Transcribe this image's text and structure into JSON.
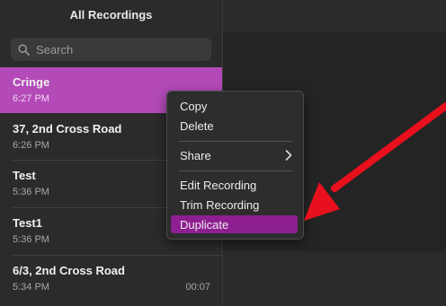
{
  "sidebar": {
    "title": "All Recordings",
    "search_placeholder": "Search",
    "recordings": [
      {
        "name": "Cringe",
        "time": "6:27 PM",
        "duration": ""
      },
      {
        "name": "37, 2nd Cross Road",
        "time": "6:26 PM",
        "duration": ""
      },
      {
        "name": "Test",
        "time": "5:36 PM",
        "duration": ""
      },
      {
        "name": "Test1",
        "time": "5:36 PM",
        "duration": ""
      },
      {
        "name": "6/3, 2nd Cross Road",
        "time": "5:34 PM",
        "duration": "00:07"
      }
    ]
  },
  "context_menu": {
    "items": [
      "Copy",
      "Delete",
      "Share",
      "Edit Recording",
      "Trim Recording",
      "Duplicate"
    ],
    "highlighted": "Duplicate"
  },
  "colors": {
    "selection": "#b34ab8",
    "menu_highlight": "#8e1f91",
    "arrow": "#e8101c"
  },
  "icons": [
    "search-icon",
    "chevron-right-icon",
    "red-arrow-annotation"
  ]
}
